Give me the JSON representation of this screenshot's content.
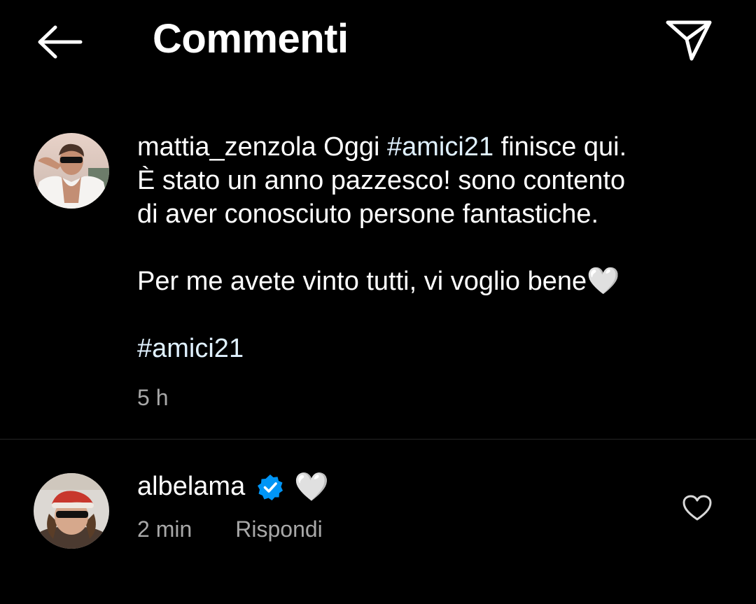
{
  "header": {
    "title": "Commenti",
    "back_icon": "arrow-left-icon",
    "send_icon": "paper-plane-icon"
  },
  "caption": {
    "username": "mattia_zenzola",
    "line1_text1": "Oggi",
    "line1_hashtag": "#amici21",
    "line1_text2": "finisce qui.",
    "line2": "È stato un anno pazzesco! sono contento",
    "line3": "di aver conosciuto persone fantastiche.",
    "line4": "Per me avete vinto tutti, vi voglio bene🤍",
    "line5_hashtag": "#amici21",
    "time": "5 h"
  },
  "comment": {
    "username": "albelama",
    "verified_icon": "verified-badge-icon",
    "text": "🤍",
    "time": "2 min",
    "reply_label": "Rispondi",
    "like_icon": "heart-outline-icon"
  },
  "colors": {
    "background": "#000000",
    "text": "#ffffff",
    "secondary_text": "#a8a8a8",
    "hashtag": "#e0f1ff",
    "verified": "#0095f6",
    "divider": "#262626"
  }
}
